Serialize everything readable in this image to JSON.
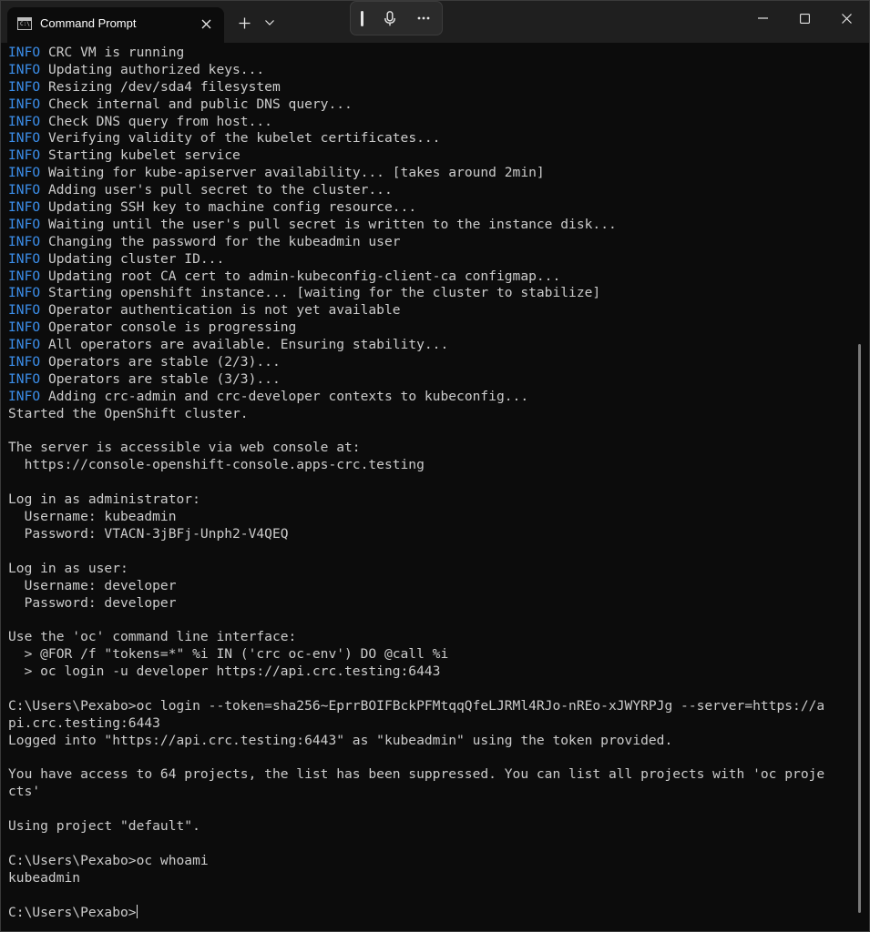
{
  "window": {
    "tab_title": "Command Prompt",
    "tab_icon_text": "C:\\"
  },
  "terminal": {
    "lines": [
      {
        "prefix": "INFO",
        "text": " CRC VM is running"
      },
      {
        "prefix": "INFO",
        "text": " Updating authorized keys..."
      },
      {
        "prefix": "INFO",
        "text": " Resizing /dev/sda4 filesystem"
      },
      {
        "prefix": "INFO",
        "text": " Check internal and public DNS query..."
      },
      {
        "prefix": "INFO",
        "text": " Check DNS query from host..."
      },
      {
        "prefix": "INFO",
        "text": " Verifying validity of the kubelet certificates..."
      },
      {
        "prefix": "INFO",
        "text": " Starting kubelet service"
      },
      {
        "prefix": "INFO",
        "text": " Waiting for kube-apiserver availability... [takes around 2min]"
      },
      {
        "prefix": "INFO",
        "text": " Adding user's pull secret to the cluster..."
      },
      {
        "prefix": "INFO",
        "text": " Updating SSH key to machine config resource..."
      },
      {
        "prefix": "INFO",
        "text": " Waiting until the user's pull secret is written to the instance disk..."
      },
      {
        "prefix": "INFO",
        "text": " Changing the password for the kubeadmin user"
      },
      {
        "prefix": "INFO",
        "text": " Updating cluster ID..."
      },
      {
        "prefix": "INFO",
        "text": " Updating root CA cert to admin-kubeconfig-client-ca configmap..."
      },
      {
        "prefix": "INFO",
        "text": " Starting openshift instance... [waiting for the cluster to stabilize]"
      },
      {
        "prefix": "INFO",
        "text": " Operator authentication is not yet available"
      },
      {
        "prefix": "INFO",
        "text": " Operator console is progressing"
      },
      {
        "prefix": "INFO",
        "text": " All operators are available. Ensuring stability..."
      },
      {
        "prefix": "INFO",
        "text": " Operators are stable (2/3)..."
      },
      {
        "prefix": "INFO",
        "text": " Operators are stable (3/3)..."
      },
      {
        "prefix": "INFO",
        "text": " Adding crc-admin and crc-developer contexts to kubeconfig..."
      },
      {
        "prefix": "",
        "text": "Started the OpenShift cluster."
      },
      {
        "prefix": "",
        "text": ""
      },
      {
        "prefix": "",
        "text": "The server is accessible via web console at:"
      },
      {
        "prefix": "",
        "text": "  https://console-openshift-console.apps-crc.testing"
      },
      {
        "prefix": "",
        "text": ""
      },
      {
        "prefix": "",
        "text": "Log in as administrator:"
      },
      {
        "prefix": "",
        "text": "  Username: kubeadmin"
      },
      {
        "prefix": "",
        "text": "  Password: VTACN-3jBFj-Unph2-V4QEQ"
      },
      {
        "prefix": "",
        "text": ""
      },
      {
        "prefix": "",
        "text": "Log in as user:"
      },
      {
        "prefix": "",
        "text": "  Username: developer"
      },
      {
        "prefix": "",
        "text": "  Password: developer"
      },
      {
        "prefix": "",
        "text": ""
      },
      {
        "prefix": "",
        "text": "Use the 'oc' command line interface:"
      },
      {
        "prefix": "",
        "text": "  > @FOR /f \"tokens=*\" %i IN ('crc oc-env') DO @call %i"
      },
      {
        "prefix": "",
        "text": "  > oc login -u developer https://api.crc.testing:6443"
      },
      {
        "prefix": "",
        "text": ""
      },
      {
        "prefix": "",
        "text": "C:\\Users\\Pexabo>oc login --token=sha256~EprrBOIFBckPFMtqqQfeLJRMl4RJo-nREo-xJWYRPJg --server=https://a"
      },
      {
        "prefix": "",
        "text": "pi.crc.testing:6443"
      },
      {
        "prefix": "",
        "text": "Logged into \"https://api.crc.testing:6443\" as \"kubeadmin\" using the token provided."
      },
      {
        "prefix": "",
        "text": ""
      },
      {
        "prefix": "",
        "text": "You have access to 64 projects, the list has been suppressed. You can list all projects with 'oc proje"
      },
      {
        "prefix": "",
        "text": "cts'"
      },
      {
        "prefix": "",
        "text": ""
      },
      {
        "prefix": "",
        "text": "Using project \"default\"."
      },
      {
        "prefix": "",
        "text": ""
      },
      {
        "prefix": "",
        "text": "C:\\Users\\Pexabo>oc whoami"
      },
      {
        "prefix": "",
        "text": "kubeadmin"
      },
      {
        "prefix": "",
        "text": ""
      }
    ],
    "prompt": "C:\\Users\\Pexabo>"
  },
  "colors": {
    "background": "#0c0c0c",
    "titlebar": "#1f1f1f",
    "text": "#cccccc",
    "info": "#3b8eea"
  }
}
